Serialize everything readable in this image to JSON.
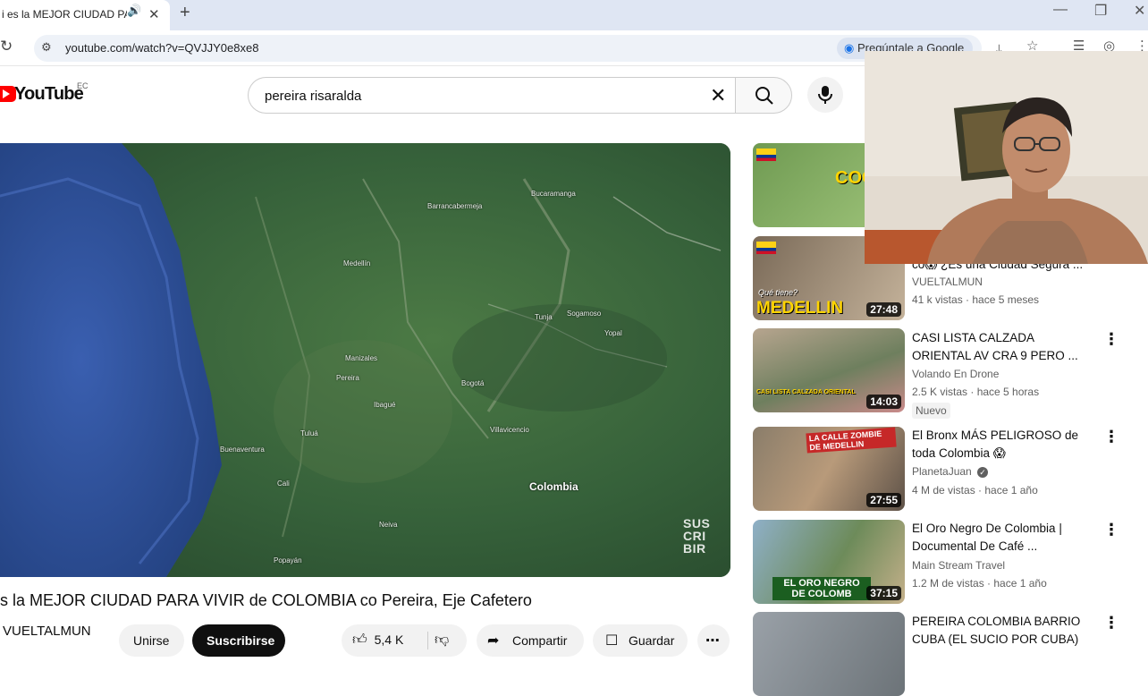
{
  "browser": {
    "tab_title": "¿Es la MEJOR CIUDAD PARA VIVIR de COLOMBIA",
    "tab_title_visible": "i es la MEJOR CIUDAD PA",
    "url": "youtube.com/watch?v=QVJJY0e8xe8",
    "ask_google": "Pregúntale a Google"
  },
  "youtube": {
    "logo_text": "YouTube",
    "region": "EC",
    "search_query": "pereira risaralda"
  },
  "video": {
    "title": "s la MEJOR CIUDAD PARA VIVIR de COLOMBIA co Pereira, Eje Cafetero",
    "channel": "VUELTALMUN",
    "join_label": "Unirse",
    "subscribe_label": "Suscribirse",
    "likes": "5,4 K",
    "share_label": "Compartir",
    "save_label": "Guardar",
    "watermark": "SUS CRI BIR",
    "map_labels": {
      "colombia": "Colombia",
      "medellin": "Medellín",
      "bogota": "Bogotá",
      "bucaramanga": "Bucaramanga",
      "manizales": "Manizales",
      "pereira": "Pereira",
      "ibague": "Ibagué",
      "tulua": "Tuluá",
      "cali": "Cali",
      "villavicencio": "Villavicencio",
      "buenaventura": "Buenaventura",
      "sogamoso": "Sogamoso",
      "tunja": "Tunja",
      "yopal": "Yopal",
      "neiva": "Neiva",
      "popayan": "Popayán",
      "barrancabermeja": "Barrancabermeja"
    }
  },
  "recommendations": [
    {
      "thumb_text": "COC",
      "title": "",
      "channel": "",
      "meta": ""
    },
    {
      "thumb_text": "MEDELLIN",
      "thumb_sub": "Qué tiene?",
      "duration": "27:48",
      "title": "co😱 ¿Es una Ciudad Segura ...",
      "channel": "VUELTALMUN",
      "meta": "41 k vistas · hace 5 meses"
    },
    {
      "thumb_text": "CASI LISTA CALZADA ORIENTAL",
      "duration": "14:03",
      "title": "CASI LISTA CALZADA ORIENTAL AV CRA 9 PERO ...",
      "channel": "Volando En Drone",
      "meta": "2.5 K vistas · hace 5 horas",
      "badge": "Nuevo"
    },
    {
      "thumb_text": "LA CALLE ZOMBIE DE MEDELLIN",
      "duration": "27:55",
      "title": "El Bronx MÁS PELIGROSO de toda Colombia 😱",
      "channel": "PlanetaJuan",
      "meta": "4 M de vistas · hace 1 año"
    },
    {
      "thumb_text": "EL ORO NEGRO DE COLOMB",
      "duration": "37:15",
      "title": "El Oro Negro De Colombia | Documental De Café ...",
      "channel": "Main Stream Travel",
      "meta": "1.2 M de vistas · hace 1 año"
    },
    {
      "thumb_text": "",
      "title": "PEREIRA COLOMBIA BARRIO CUBA (EL SUCIO POR CUBA)",
      "channel": "",
      "meta": ""
    }
  ],
  "colors": {
    "yt_red": "#ff0000",
    "map_green": "#3b6b3e",
    "ocean_blue": "#2d4f96",
    "subscribe_bg": "#0f0f0f"
  }
}
